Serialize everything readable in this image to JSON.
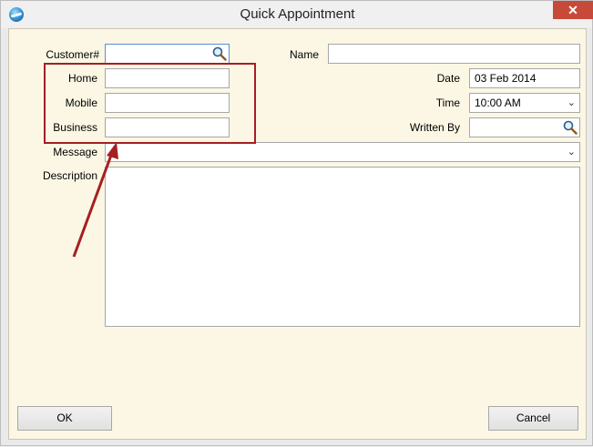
{
  "window": {
    "title": "Quick Appointment",
    "close_glyph": "✕"
  },
  "form": {
    "customer_label": "Customer#",
    "name_label": "Name",
    "home_label": "Home",
    "mobile_label": "Mobile",
    "business_label": "Business",
    "date_label": "Date",
    "date_value": "03 Feb 2014",
    "time_label": "Time",
    "time_value": "10:00 AM",
    "written_by_label": "Written By",
    "message_label": "Message",
    "description_label": "Description"
  },
  "buttons": {
    "ok": "OK",
    "cancel": "Cancel"
  },
  "annotation": {
    "highlight_color": "#a51f23"
  },
  "colors": {
    "panel_bg": "#fbf7e4",
    "accent": "#5b8fd6"
  }
}
